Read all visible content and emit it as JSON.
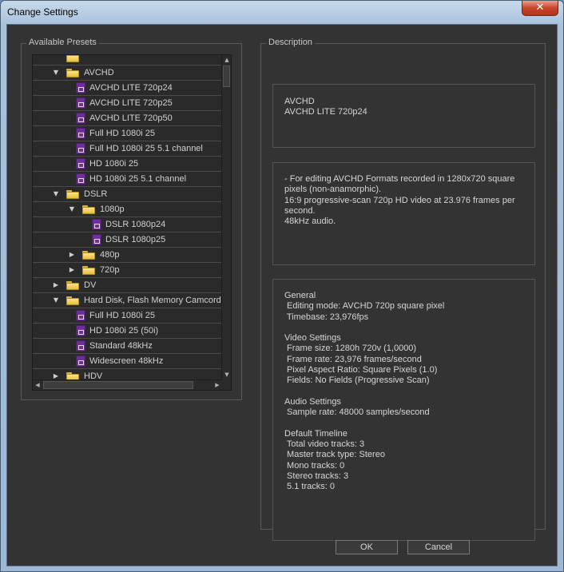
{
  "window": {
    "title": "Change Settings",
    "close_label": "✕"
  },
  "presets": {
    "group_label": "Available Presets",
    "rows": [
      {
        "label": "",
        "kind": "folder",
        "level": 1,
        "arrow": ""
      },
      {
        "label": "AVCHD",
        "kind": "folder",
        "level": 1,
        "arrow": "▼"
      },
      {
        "label": "AVCHD LITE 720p24",
        "kind": "preset",
        "level": 3,
        "arrow": ""
      },
      {
        "label": "AVCHD LITE 720p25",
        "kind": "preset",
        "level": 3,
        "arrow": ""
      },
      {
        "label": "AVCHD LITE 720p50",
        "kind": "preset",
        "level": 3,
        "arrow": ""
      },
      {
        "label": "Full HD 1080i 25",
        "kind": "preset",
        "level": 3,
        "arrow": ""
      },
      {
        "label": "Full HD 1080i 25 5.1 channel",
        "kind": "preset",
        "level": 3,
        "arrow": ""
      },
      {
        "label": "HD 1080i 25",
        "kind": "preset",
        "level": 3,
        "arrow": ""
      },
      {
        "label": "HD 1080i 25 5.1 channel",
        "kind": "preset",
        "level": 3,
        "arrow": ""
      },
      {
        "label": "DSLR",
        "kind": "folder",
        "level": 1,
        "arrow": "▼"
      },
      {
        "label": "1080p",
        "kind": "folder",
        "level": 2,
        "arrow": "▼"
      },
      {
        "label": "DSLR 1080p24",
        "kind": "preset",
        "level": 4,
        "arrow": ""
      },
      {
        "label": "DSLR 1080p25",
        "kind": "preset",
        "level": 4,
        "arrow": ""
      },
      {
        "label": "480p",
        "kind": "folder",
        "level": 2,
        "arrow": "▶"
      },
      {
        "label": "720p",
        "kind": "folder",
        "level": 2,
        "arrow": "▶"
      },
      {
        "label": "DV",
        "kind": "folder",
        "level": 1,
        "arrow": "▶"
      },
      {
        "label": "Hard Disk, Flash Memory Camcorders",
        "kind": "folder",
        "level": 1,
        "arrow": "▼"
      },
      {
        "label": "Full HD 1080i 25",
        "kind": "preset",
        "level": 3,
        "arrow": ""
      },
      {
        "label": "HD 1080i 25 (50i)",
        "kind": "preset",
        "level": 3,
        "arrow": ""
      },
      {
        "label": "Standard 48kHz",
        "kind": "preset",
        "level": 3,
        "arrow": ""
      },
      {
        "label": "Widescreen 48kHz",
        "kind": "preset",
        "level": 3,
        "arrow": ""
      },
      {
        "label": "HDV",
        "kind": "folder",
        "level": 1,
        "arrow": "▶"
      }
    ],
    "scroll_up": "▲",
    "scroll_down": "▼",
    "scroll_left": "◀",
    "scroll_right": "▶"
  },
  "description": {
    "group_label": "Description",
    "box1": [
      "AVCHD",
      "AVCHD LITE 720p24"
    ],
    "box2": [
      "- For editing AVCHD Formats recorded in 1280x720 square",
      "pixels (non-anamorphic).",
      "16:9 progressive-scan 720p HD video at 23.976 frames per",
      "second.",
      "48kHz audio."
    ],
    "box3": [
      "General",
      " Editing mode: AVCHD 720p square pixel",
      " Timebase: 23,976fps",
      "",
      "Video Settings",
      " Frame size: 1280h 720v (1,0000)",
      " Frame rate: 23,976 frames/second",
      " Pixel Aspect Ratio: Square Pixels (1.0)",
      " Fields: No Fields (Progressive Scan)",
      "",
      "Audio Settings",
      " Sample rate: 48000 samples/second",
      "",
      "Default Timeline",
      " Total video tracks: 3",
      " Master track type: Stereo",
      " Mono tracks: 0",
      " Stereo tracks: 3",
      " 5.1 tracks: 0"
    ]
  },
  "buttons": {
    "ok": "OK",
    "cancel": "Cancel"
  }
}
